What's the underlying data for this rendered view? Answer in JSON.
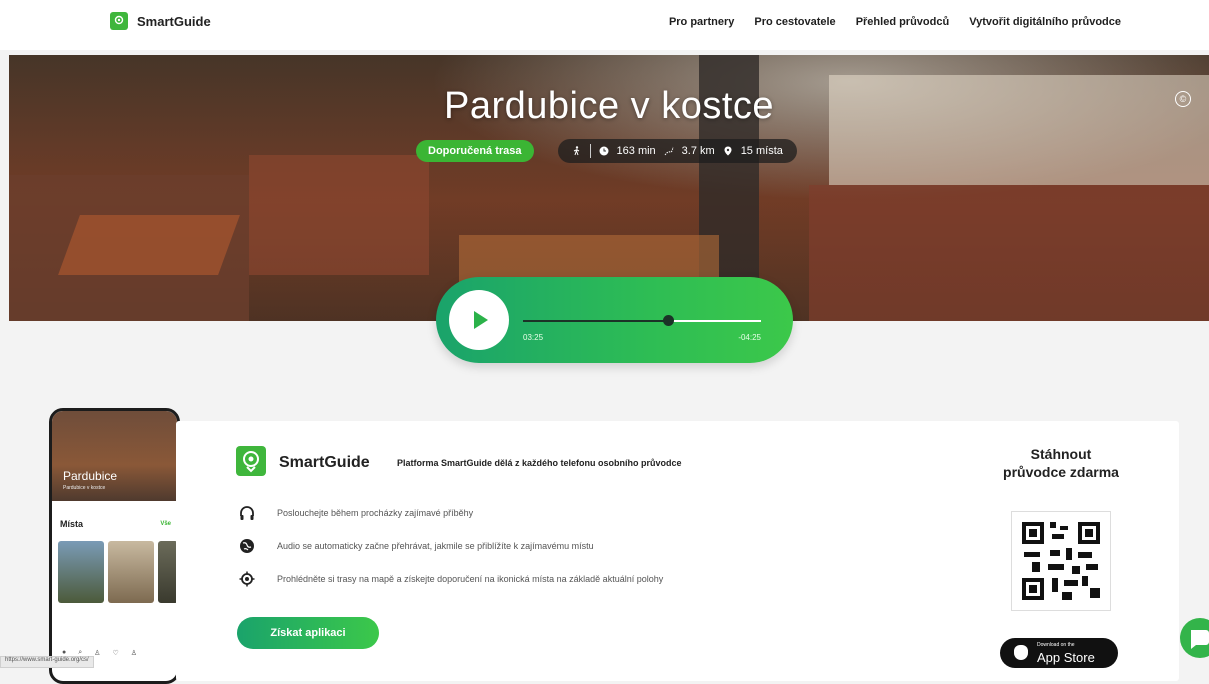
{
  "header": {
    "brand": "SmartGuide",
    "nav": [
      "Pro partnery",
      "Pro cestovatele",
      "Přehled průvodců",
      "Vytvořit digitálního průvodce"
    ]
  },
  "hero": {
    "title": "Pardubice v kostce",
    "tag": "Doporučená trasa",
    "duration": "163 min",
    "distance": "3.7 km",
    "places": "15 místa",
    "copyright": "©"
  },
  "player": {
    "elapsed": "03:25",
    "remaining": "-04:25",
    "progress": 0.61
  },
  "phone": {
    "title": "Pardubice",
    "subtitle": "Pardubice v kostce",
    "section": "Místa",
    "all": "Vše"
  },
  "card": {
    "brand": "SmartGuide",
    "tagline": "Platforma SmartGuide dělá z každého telefonu osobního průvodce",
    "features": [
      "Poslouchejte během procházky zajímavé příběhy",
      "Audio se automaticky začne přehrávat, jakmile se přiblížíte k zajímavému místu",
      "Prohlédněte si trasy na mapě a získejte doporučení na ikonická místa na základě aktuální polohy"
    ],
    "cta": "Získat aplikaci",
    "download_title": "Stáhnout průvodce zdarma",
    "appstore_small": "Download on the",
    "appstore_big": "App Store"
  },
  "statusbar": {
    "url": "https://www.smart-guide.org/cs/"
  },
  "colors": {
    "accent": "#3bb534",
    "gradient_start": "#1aa36b",
    "gradient_end": "#3cc84a"
  }
}
